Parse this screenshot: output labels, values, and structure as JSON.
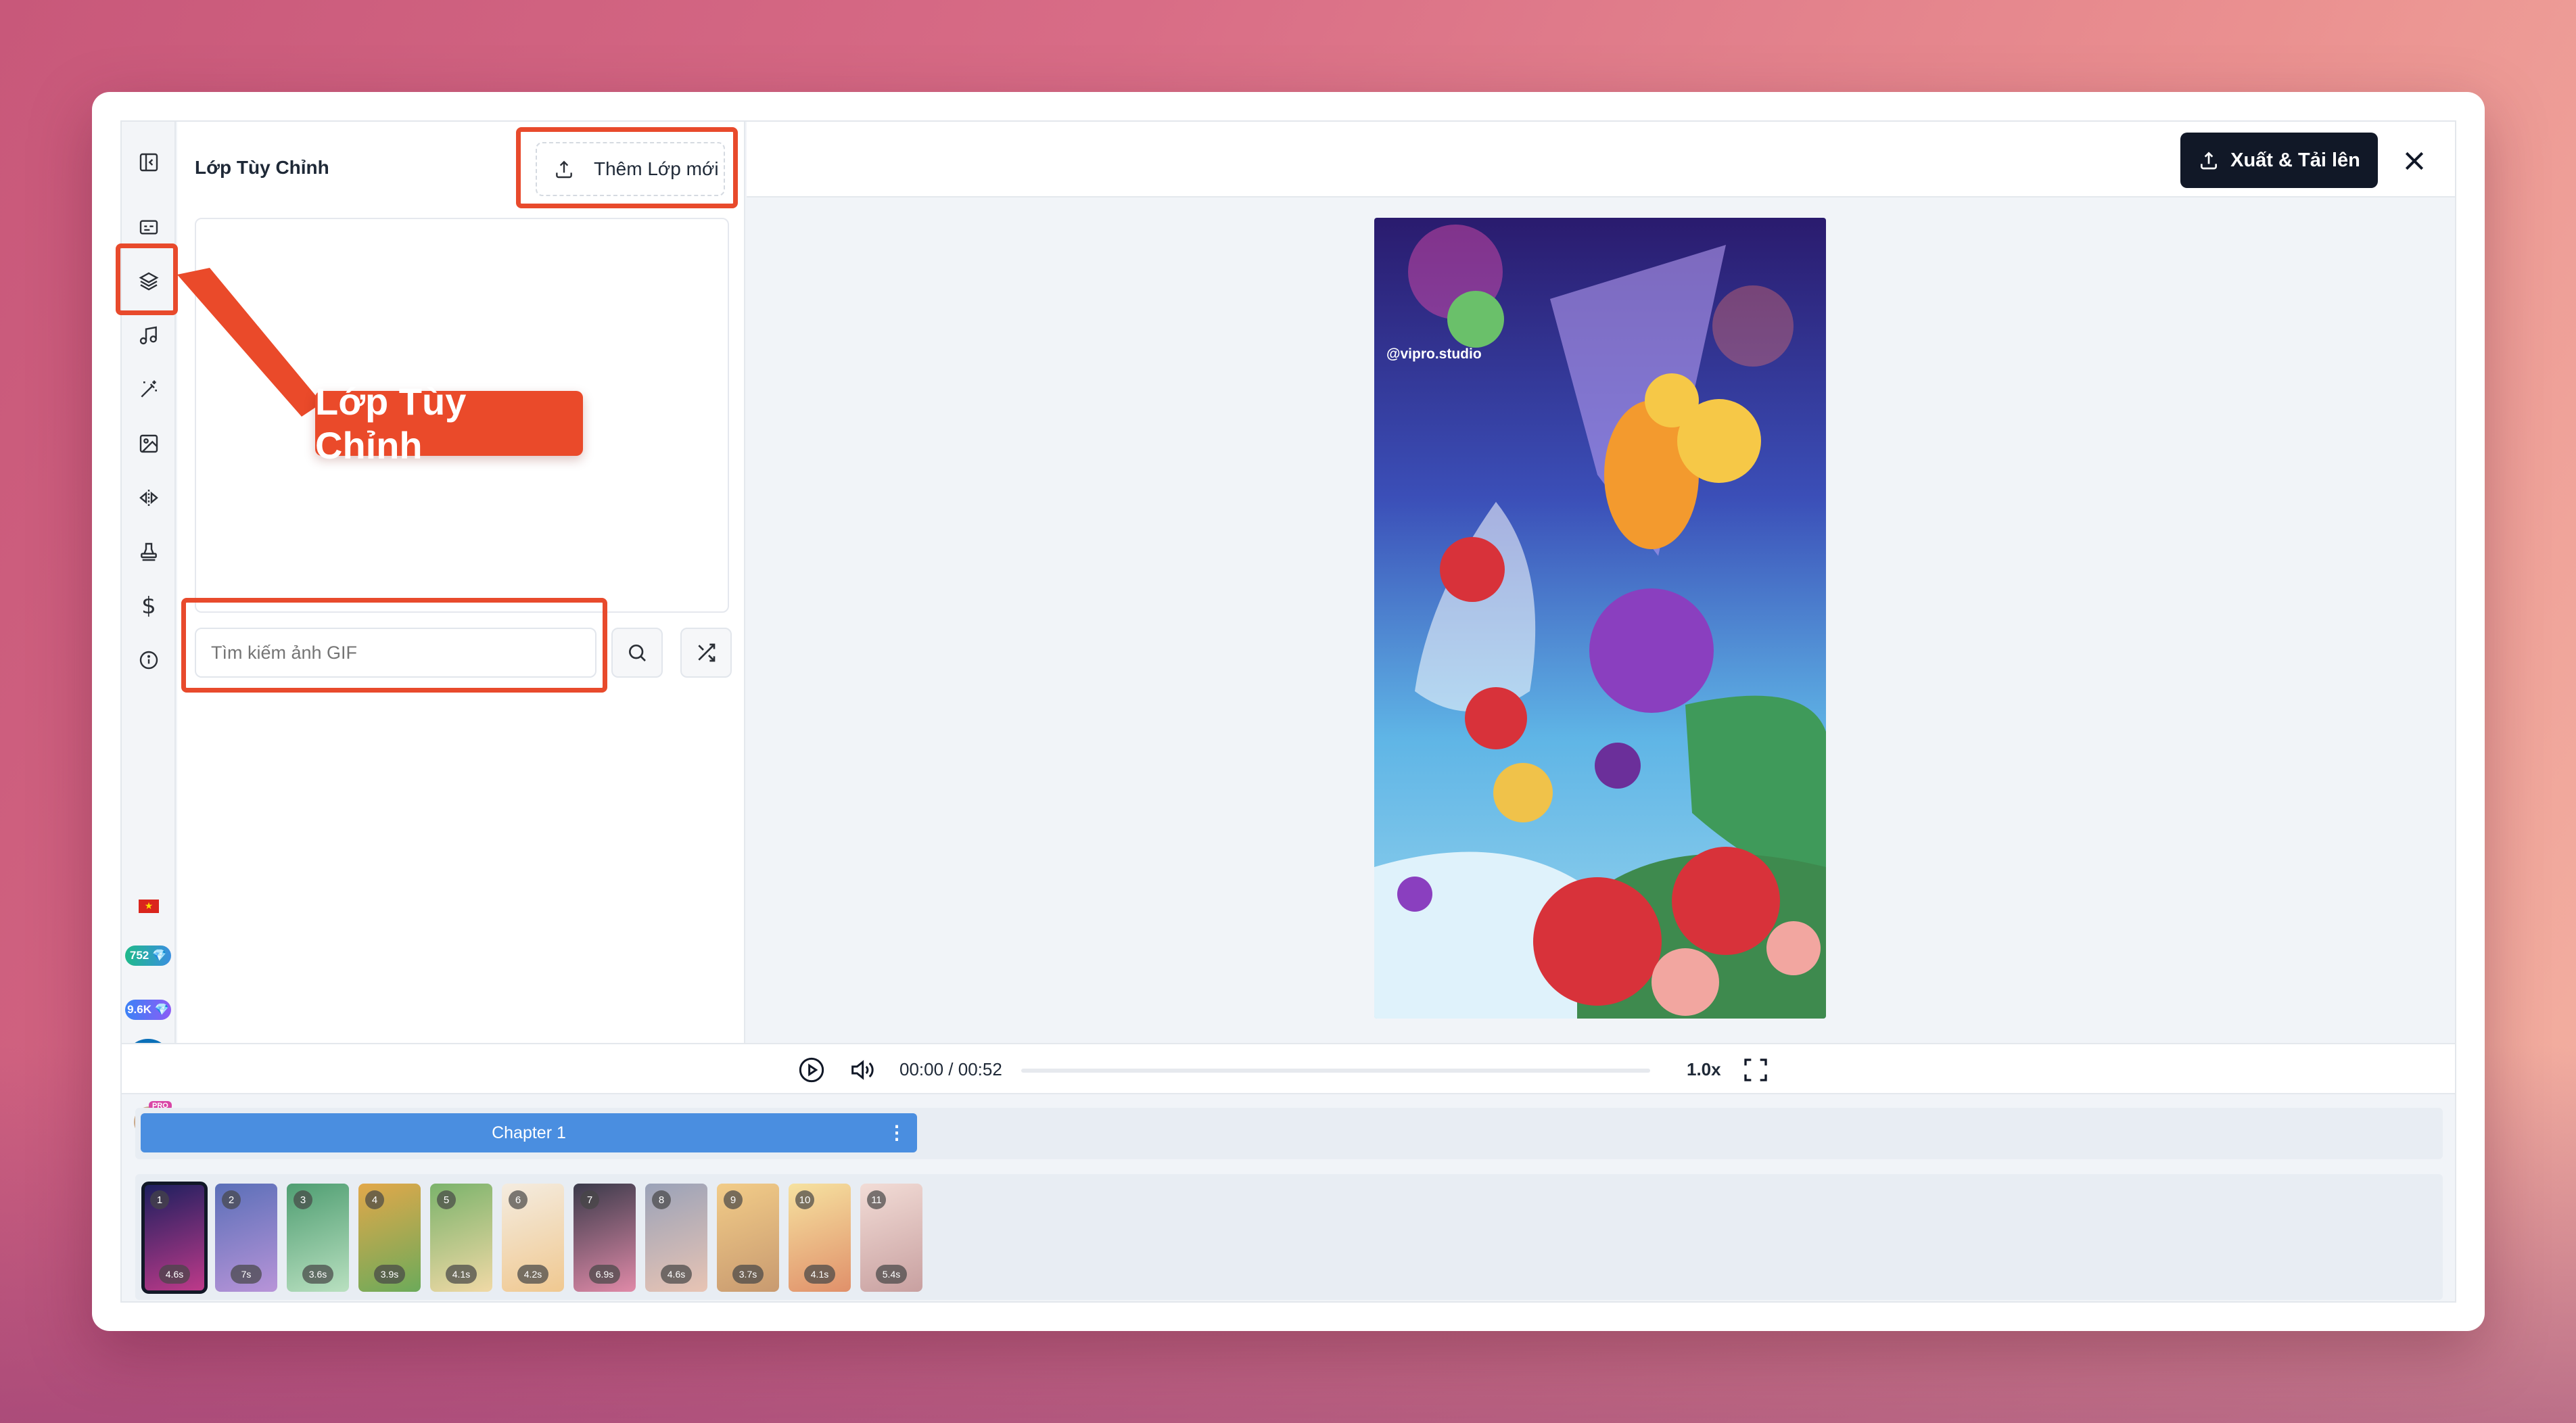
{
  "panel": {
    "title": "Lớp Tùy Chỉnh",
    "add_layer_label": "Thêm Lớp mới",
    "gif_search_placeholder": "Tìm kiếm ảnh GIF"
  },
  "callout": {
    "label": "Lớp Tùy Chỉnh"
  },
  "rail": {
    "icons": [
      "collapse-sidebar-icon",
      "subtitles-icon",
      "layers-icon",
      "music-icon",
      "magic-wand-icon",
      "image-edit-icon",
      "flip-icon",
      "stamp-icon",
      "dollar-icon",
      "info-icon"
    ],
    "dollar_glyph": "$",
    "flag": "★",
    "badge_one": "752 💎",
    "badge_two": "9.6K 💎",
    "avatar_badge": "PRO"
  },
  "header": {
    "export_label": "Xuất & Tải lên"
  },
  "preview": {
    "watermark": "@vipro.studio"
  },
  "player": {
    "time": "00:00 / 00:52",
    "speed": "1.0x",
    "progress": 0
  },
  "chapters": [
    {
      "label": "Chapter 1",
      "menu": "⋮"
    }
  ],
  "scenes": [
    {
      "number": "1",
      "duration": "4.6s",
      "colors": [
        "#1b1f5e",
        "#c03a8a"
      ]
    },
    {
      "number": "2",
      "duration": "7s",
      "colors": [
        "#5a6fb8",
        "#b894d8"
      ]
    },
    {
      "number": "3",
      "duration": "3.6s",
      "colors": [
        "#4f9e72",
        "#b9e0c0"
      ]
    },
    {
      "number": "4",
      "duration": "3.9s",
      "colors": [
        "#e2a84a",
        "#6caa5a"
      ]
    },
    {
      "number": "5",
      "duration": "4.1s",
      "colors": [
        "#7bb36b",
        "#f0d9a6"
      ]
    },
    {
      "number": "6",
      "duration": "4.2s",
      "colors": [
        "#f4ece0",
        "#f0c890"
      ]
    },
    {
      "number": "7",
      "duration": "6.9s",
      "colors": [
        "#3a3a4a",
        "#e08aa8"
      ]
    },
    {
      "number": "8",
      "duration": "4.6s",
      "colors": [
        "#9aa2b8",
        "#e8c4b4"
      ]
    },
    {
      "number": "9",
      "duration": "3.7s",
      "colors": [
        "#f2cc88",
        "#c89a70"
      ]
    },
    {
      "number": "10",
      "duration": "4.1s",
      "colors": [
        "#f6e2a0",
        "#e0906a"
      ]
    },
    {
      "number": "11",
      "duration": "5.4s",
      "colors": [
        "#f2dcd6",
        "#c8a0a0"
      ]
    }
  ]
}
